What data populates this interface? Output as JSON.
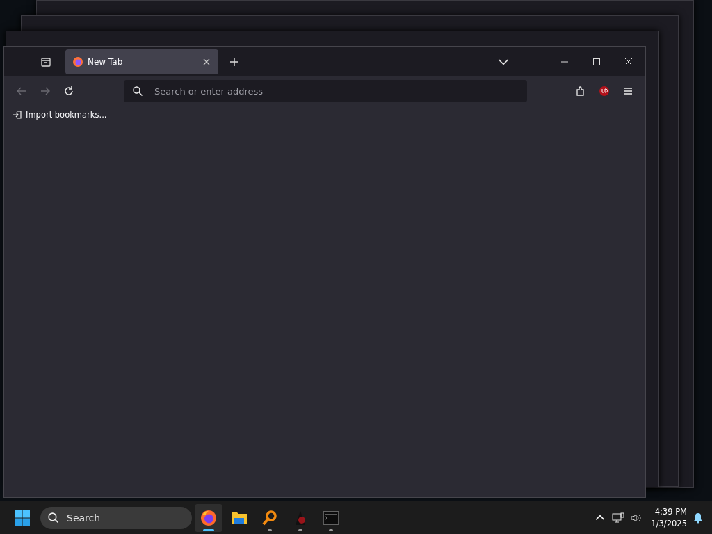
{
  "window": {
    "tabs": [
      {
        "label": "New Tab",
        "selected": true
      }
    ],
    "address_bar": {
      "placeholder": "Search or enter address"
    },
    "toolbar": {
      "back_disabled": true,
      "forward_disabled": true
    },
    "bookmarks_bar": {
      "items": [
        {
          "label": "Import bookmarks..."
        }
      ]
    }
  },
  "taskbar": {
    "search": {
      "placeholder": "Search"
    },
    "apps": [
      {
        "kind": "firefox",
        "selected": true,
        "running": true
      },
      {
        "kind": "files",
        "selected": false,
        "running": false
      },
      {
        "kind": "magnifier",
        "selected": false,
        "running": true
      },
      {
        "kind": "hacker",
        "selected": false,
        "running": true
      },
      {
        "kind": "terminal",
        "selected": false,
        "running": true
      }
    ],
    "clock": {
      "time": "4:39 PM",
      "date": "1/3/2025"
    }
  }
}
